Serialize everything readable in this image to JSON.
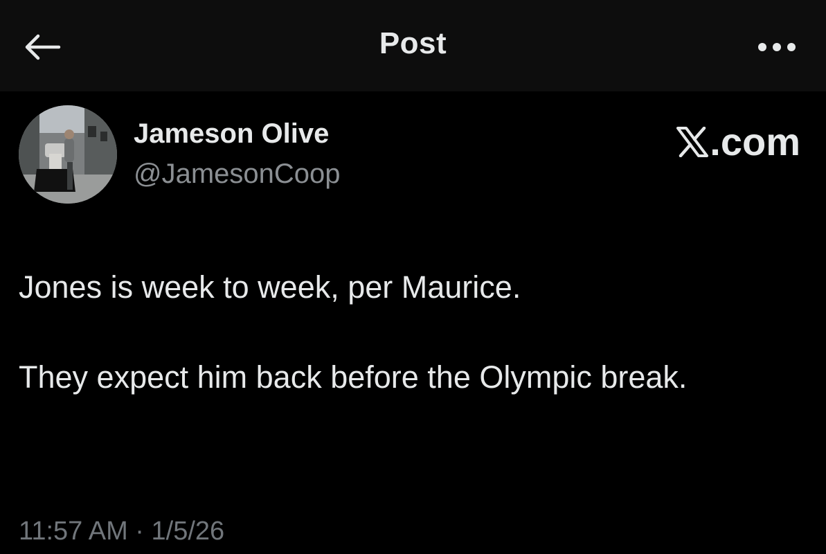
{
  "header": {
    "title": "Post",
    "back_icon": "arrow-left-icon",
    "more_icon": "more-horizontal-icon"
  },
  "author": {
    "display_name": "Jameson Olive",
    "handle": "@JamesonCoop",
    "avatar_icon": "avatar-photo"
  },
  "brand": {
    "label": ".com",
    "logo_icon": "x-logo-icon"
  },
  "post": {
    "paragraphs": [
      "Jones is week to week, per Maurice.",
      "They expect him back before the Olympic break."
    ]
  },
  "meta": {
    "time": "11:57 AM",
    "separator": "·",
    "date": "1/5/26"
  },
  "colors": {
    "background": "#000000",
    "header_bg": "#0d0d0d",
    "text_primary": "#e7e9ea",
    "text_secondary": "#71767b"
  }
}
